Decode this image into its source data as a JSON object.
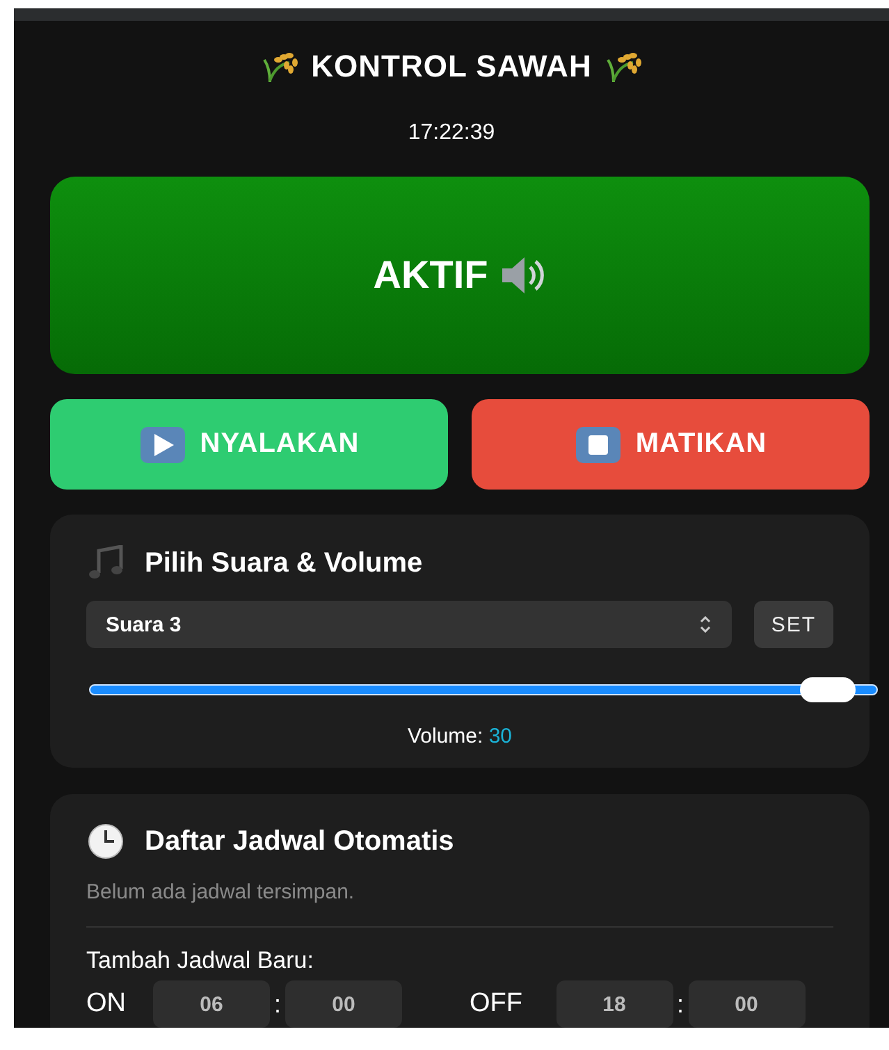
{
  "header": {
    "title": "KONTROL SAWAH",
    "time": "17:22:39"
  },
  "status": {
    "label": "AKTIF",
    "active": true
  },
  "buttons": [
    {
      "label": "NYALAKAN",
      "kind": "on"
    },
    {
      "label": "MATIKAN",
      "kind": "off"
    }
  ],
  "sound_card": {
    "title": "Pilih Suara & Volume",
    "select": {
      "value": "Suara 3"
    },
    "set_button": "SET",
    "volume": {
      "level": 0.97,
      "label": "Volume:",
      "value": "30"
    }
  },
  "schedule_card": {
    "title": "Daftar Jadwal Otomatis",
    "empty_text": "Belum ada jadwal tersimpan.",
    "add_label": "Tambah Jadwal Baru:",
    "times": [
      {
        "label": "ON",
        "hour": "06",
        "separator": ":",
        "minute": "00"
      },
      {
        "label": "OFF",
        "hour": "18",
        "separator": ":",
        "minute": "00"
      }
    ]
  }
}
